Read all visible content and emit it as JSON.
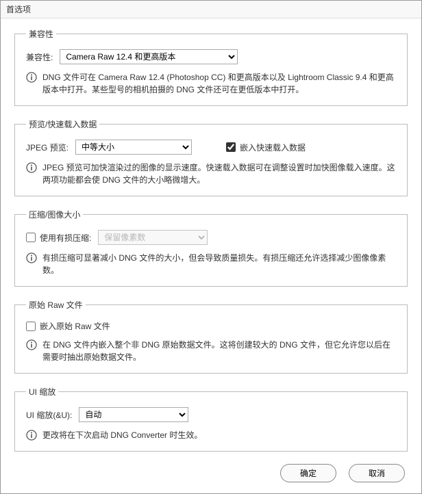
{
  "title": "首选项",
  "sections": {
    "compat": {
      "legend": "兼容性",
      "label": "兼容性:",
      "value": "Camera Raw 12.4 和更高版本",
      "info": "DNG 文件可在 Camera Raw 12.4 (Photoshop CC) 和更高版本以及 Lightroom Classic 9.4 和更高版本中打开。某些型号的相机拍摄的 DNG 文件还可在更低版本中打开。"
    },
    "preview": {
      "legend": "预览/快速载入数据",
      "jpeg_label": "JPEG 预览:",
      "jpeg_value": "中等大小",
      "embed_label": "嵌入快速载入数据",
      "info": "JPEG 预览可加快渲染过的图像的显示速度。快速载入数据可在调整设置时加快图像载入速度。这两项功能都会使 DNG 文件的大小略微增大。"
    },
    "compress": {
      "legend": "压缩/图像大小",
      "lossy_label": "使用有损压缩:",
      "lossy_value": "保留像素数",
      "info": "有损压缩可显著减小 DNG 文件的大小，但会导致质量损失。有损压缩还允许选择减少图像像素数。"
    },
    "raw": {
      "legend": "原始 Raw 文件",
      "embed_label": "嵌入原始 Raw 文件",
      "info": "在 DNG 文件内嵌入整个非 DNG 原始数据文件。这将创建较大的 DNG 文件，但它允许您以后在需要时抽出原始数据文件。"
    },
    "ui": {
      "legend": "UI 缩放",
      "label": "UI 缩放(&U):",
      "value": "自动",
      "info": "更改将在下次启动 DNG Converter 时生效。"
    }
  },
  "buttons": {
    "ok": "确定",
    "cancel": "取消"
  }
}
